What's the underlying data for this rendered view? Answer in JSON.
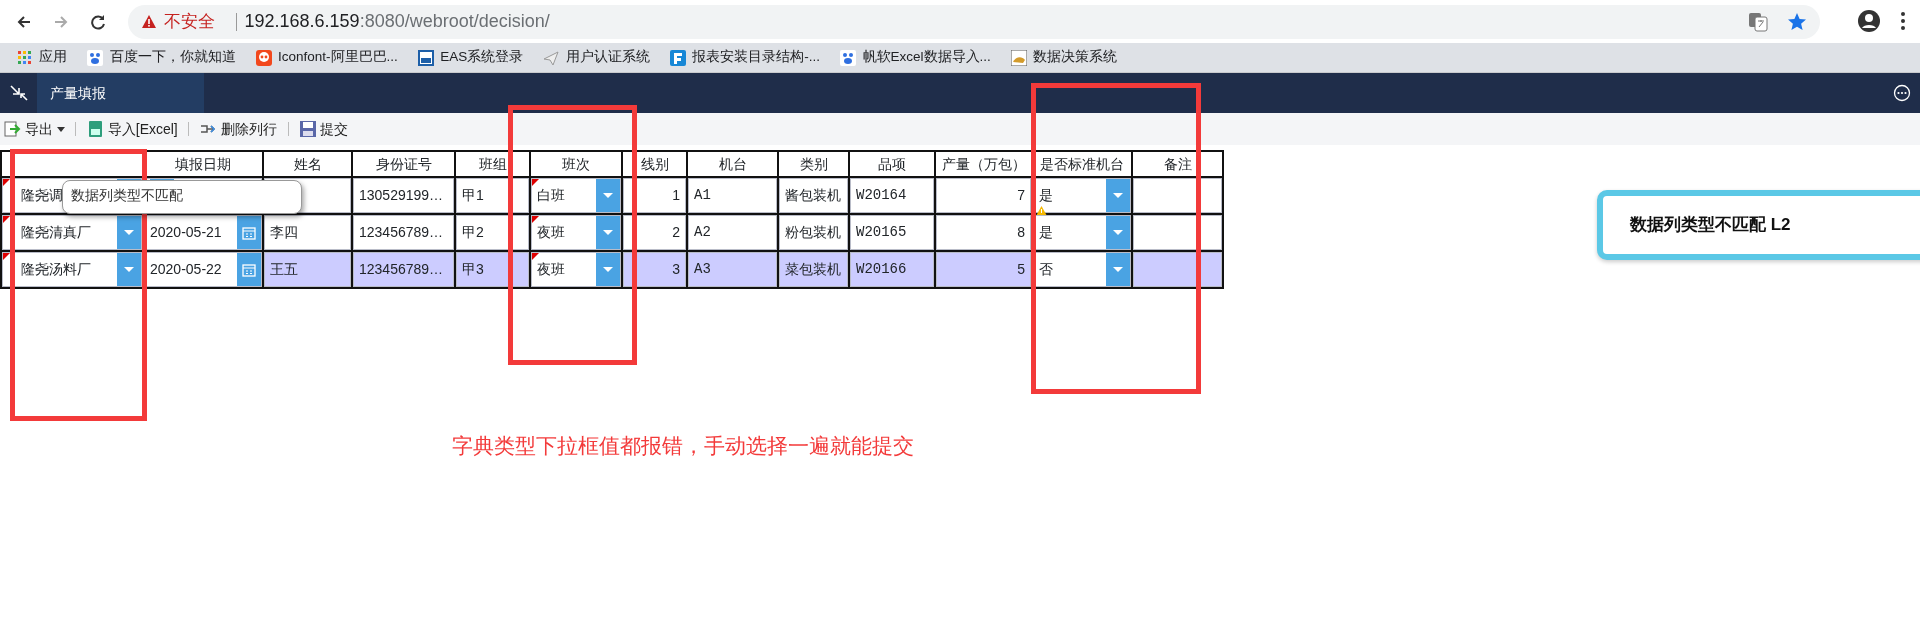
{
  "browser": {
    "security": "不安全",
    "url_host": "192.168.6.159",
    "url_path": ":8080/webroot/decision/",
    "bookmarks": [
      {
        "label": "应用",
        "kind": "apps"
      },
      {
        "label": "百度一下，你就知道",
        "kind": "paw"
      },
      {
        "label": "Iconfont-阿里巴巴...",
        "kind": "iconfont"
      },
      {
        "label": "EAS系统登录",
        "kind": "eas"
      },
      {
        "label": "用户认证系统",
        "kind": "plane"
      },
      {
        "label": "报表安装目录结构-...",
        "kind": "finereport"
      },
      {
        "label": "帆软Excel数据导入...",
        "kind": "paw"
      },
      {
        "label": "数据决策系统",
        "kind": "tomcat"
      }
    ]
  },
  "app": {
    "tabs": [
      {
        "label": "产量填报",
        "selected": true
      }
    ]
  },
  "toolbar": [
    {
      "label": "导出",
      "kind": "export"
    },
    {
      "label": "导入[Excel]",
      "kind": "import"
    },
    {
      "label": "删除列行",
      "kind": "delete"
    },
    {
      "label": "提交",
      "kind": "submit"
    }
  ],
  "table": {
    "columns": [
      "",
      "填报日期",
      "姓名",
      "身份证号",
      "班组",
      "班次",
      "线别",
      "机台",
      "类别",
      "品项",
      "产量（万包）",
      "是否标准机台",
      "备注"
    ],
    "rows": [
      {
        "selected": false,
        "cells": [
          {
            "text": "隆尧调",
            "kind": "combo",
            "error": true,
            "warning": false
          },
          {
            "kind": "date"
          },
          {
            "kind": "text"
          },
          {
            "text": "130529199…",
            "kind": "text"
          },
          {
            "text": "甲1",
            "kind": "text"
          },
          {
            "text": "白班",
            "kind": "combo",
            "error": true,
            "warning": false
          },
          {
            "text": "1",
            "kind": "num"
          },
          {
            "text": "A1",
            "kind": "mono"
          },
          {
            "text": "酱包装机",
            "kind": "text"
          },
          {
            "text": "W20164",
            "kind": "mono"
          },
          {
            "text": "7",
            "kind": "num"
          },
          {
            "text": "是",
            "kind": "combo",
            "error": false,
            "warning": true
          },
          {
            "kind": "text"
          }
        ]
      },
      {
        "selected": false,
        "cells": [
          {
            "text": "隆尧清真厂",
            "kind": "combo",
            "error": true,
            "warning": false
          },
          {
            "text": "2020-05-21",
            "kind": "date"
          },
          {
            "text": "李四",
            "kind": "text"
          },
          {
            "text": "123456789…",
            "kind": "text"
          },
          {
            "text": "甲2",
            "kind": "text"
          },
          {
            "text": "夜班",
            "kind": "combo",
            "error": true,
            "warning": false
          },
          {
            "text": "2",
            "kind": "num"
          },
          {
            "text": "A2",
            "kind": "mono"
          },
          {
            "text": "粉包装机",
            "kind": "text"
          },
          {
            "text": "W20165",
            "kind": "mono"
          },
          {
            "text": "8",
            "kind": "num"
          },
          {
            "text": "是",
            "kind": "combo",
            "error": false,
            "warning": false
          },
          {
            "kind": "text"
          }
        ]
      },
      {
        "selected": true,
        "cells": [
          {
            "text": "隆尧汤料厂",
            "kind": "combo",
            "error": true,
            "warning": false
          },
          {
            "text": "2020-05-22",
            "kind": "date"
          },
          {
            "text": "王五",
            "kind": "text"
          },
          {
            "text": "123456789…",
            "kind": "text"
          },
          {
            "text": "甲3",
            "kind": "text"
          },
          {
            "text": "夜班",
            "kind": "combo",
            "error": true,
            "warning": false
          },
          {
            "text": "3",
            "kind": "num"
          },
          {
            "text": "A3",
            "kind": "mono"
          },
          {
            "text": "菜包装机",
            "kind": "text"
          },
          {
            "text": "W20166",
            "kind": "mono"
          },
          {
            "text": "5",
            "kind": "num"
          },
          {
            "text": "否",
            "kind": "combo",
            "error": false,
            "warning": false
          },
          {
            "kind": "text"
          }
        ]
      }
    ]
  },
  "tooltip": {
    "text": "数据列类型不匹配"
  },
  "notice": {
    "text": "数据列类型不匹配 L2"
  },
  "annotation": {
    "text": "字典类型下拉框值都报错，手动选择一遍就能提交"
  }
}
